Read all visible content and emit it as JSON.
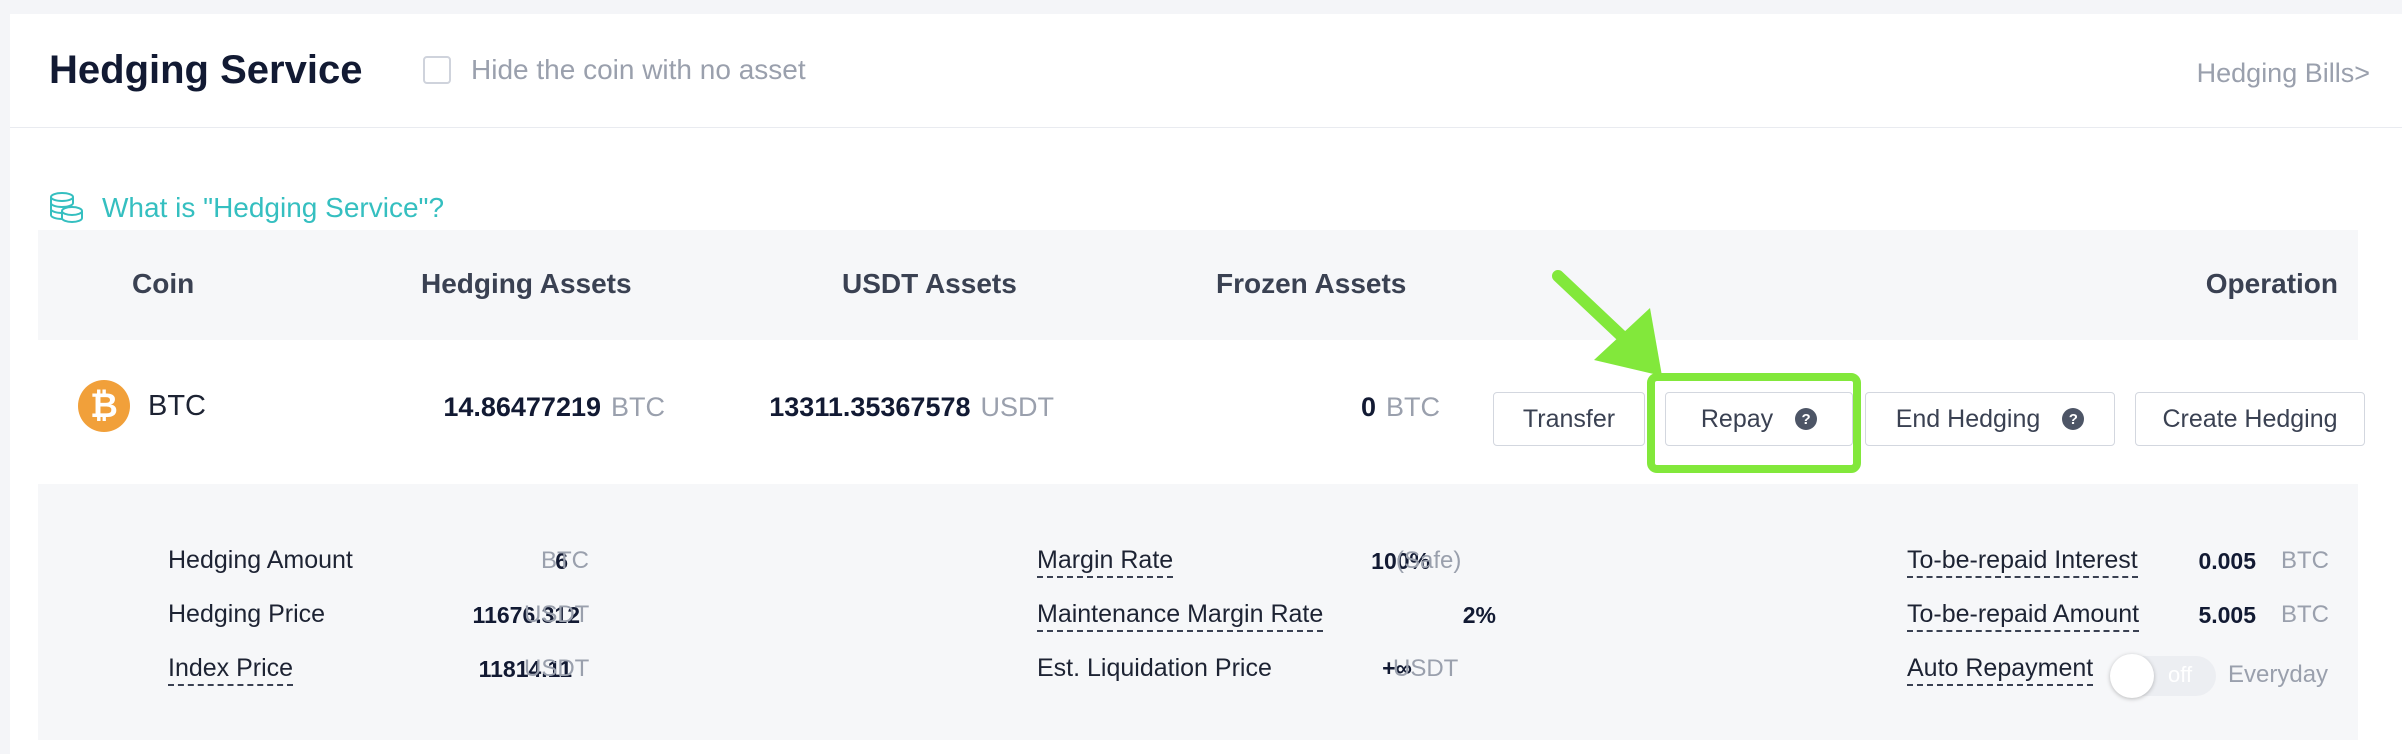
{
  "header": {
    "title": "Hedging Service",
    "hide_label": "Hide the coin with no asset",
    "hide_checked": false,
    "bills_link": "Hedging Bills>"
  },
  "whatis": {
    "text": "What is \"Hedging Service\"?",
    "icon": "coins-stack-icon"
  },
  "table": {
    "columns": [
      "Coin",
      "Hedging Assets",
      "USDT Assets",
      "Frozen Assets",
      "Operation"
    ],
    "row": {
      "coin_icon": "bitcoin-icon",
      "coin_icon_glyph": "₿",
      "coin": "BTC",
      "hedging_assets": {
        "value": "14.86477219",
        "unit": "BTC"
      },
      "usdt_assets": {
        "value": "13311.35367578",
        "unit": "USDT"
      },
      "frozen_assets": {
        "value": "0",
        "unit": "BTC"
      },
      "buttons": {
        "transfer": "Transfer",
        "repay": "Repay",
        "end_hedging": "End Hedging",
        "create_hedging": "Create Hedging",
        "help_glyph": "?"
      }
    }
  },
  "details": {
    "hedging_amount": {
      "label": "Hedging Amount",
      "value": "6",
      "unit": "BTC"
    },
    "hedging_price": {
      "label": "Hedging Price",
      "value": "11676.312",
      "unit": "USDT"
    },
    "index_price": {
      "label": "Index Price",
      "value": "11814.11",
      "unit": "USDT"
    },
    "margin_rate": {
      "label": "Margin Rate",
      "value": "100%",
      "unit": "(Safe)"
    },
    "maintenance_margin_rate": {
      "label": "Maintenance Margin Rate",
      "value": "2%"
    },
    "est_liquidation_price": {
      "label": "Est. Liquidation Price",
      "value": "+∞",
      "unit": "USDT"
    },
    "to_be_repaid_interest": {
      "label": "To-be-repaid Interest",
      "value": "0.005",
      "unit": "BTC"
    },
    "to_be_repaid_amount": {
      "label": "To-be-repaid Amount",
      "value": "5.005",
      "unit": "BTC"
    },
    "auto_repayment": {
      "label": "Auto Repayment",
      "toggle_text": "off",
      "enabled": false,
      "frequency": "Everyday"
    }
  },
  "colors": {
    "accent": "#35bfc0",
    "highlight": "#82e83b",
    "btc": "#f1a03a"
  }
}
